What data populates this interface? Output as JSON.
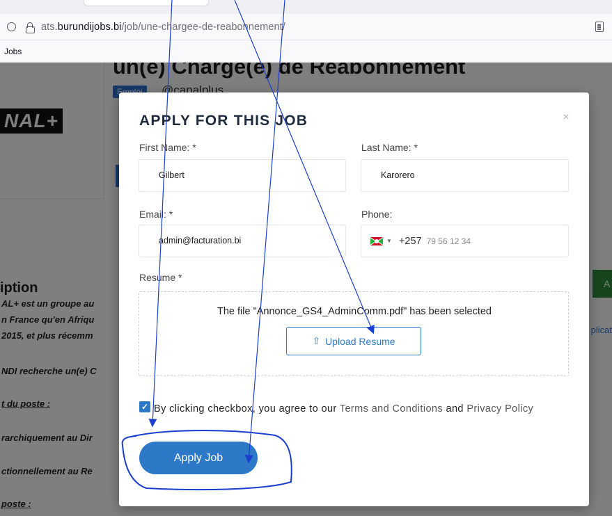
{
  "browser": {
    "url_prefix": "ats.",
    "url_domain": "burundijobs.bi",
    "url_path": "/job/une-chargee-de-reabonnement/",
    "bookmark": "Jobs"
  },
  "background_page": {
    "job_title": "un(e) Chargé(e) de Réabonnement",
    "badge": "Emploi",
    "company": "@canalplus",
    "logo": "NAL+",
    "section_title": "iption",
    "lines": [
      "AL+ est un groupe au",
      "n France qu'en Afriqu",
      " 2015, et plus récemm",
      "NDI recherche un(e) C",
      "t du poste :",
      "rarchiquement au Dir",
      "ctionnellement au Re",
      "poste :"
    ],
    "right_button": "A",
    "right_link": "plicat"
  },
  "modal": {
    "title": "APPLY FOR THIS JOB",
    "close": "×",
    "first_name_label": "First Name: *",
    "first_name_value": "Gilbert",
    "last_name_label": "Last Name: *",
    "last_name_value": "Karorero",
    "email_label": "Email: *",
    "email_value": "admin@facturation.bi",
    "phone_label": "Phone:",
    "phone_dial_code": "+257",
    "phone_placeholder": "79 56 12 34",
    "resume_label": "Resume *",
    "resume_status": "The file \"Annonce_GS4_AdminComm.pdf\" has been selected",
    "upload_label": "Upload Resume",
    "terms_prefix": "By clicking checkbox, you agree to our ",
    "terms_link": "Terms and Conditions",
    "terms_and": " and ",
    "privacy_link": "Privacy Policy",
    "apply_label": "Apply Job"
  },
  "colors": {
    "primary": "#2e78c8",
    "annotation": "#1a3fcf"
  },
  "icons": [
    "shield-icon",
    "lock-icon",
    "reader-view-icon",
    "close-icon",
    "burundi-flag-icon",
    "caret-down-icon",
    "upload-icon",
    "checkmark-icon"
  ]
}
